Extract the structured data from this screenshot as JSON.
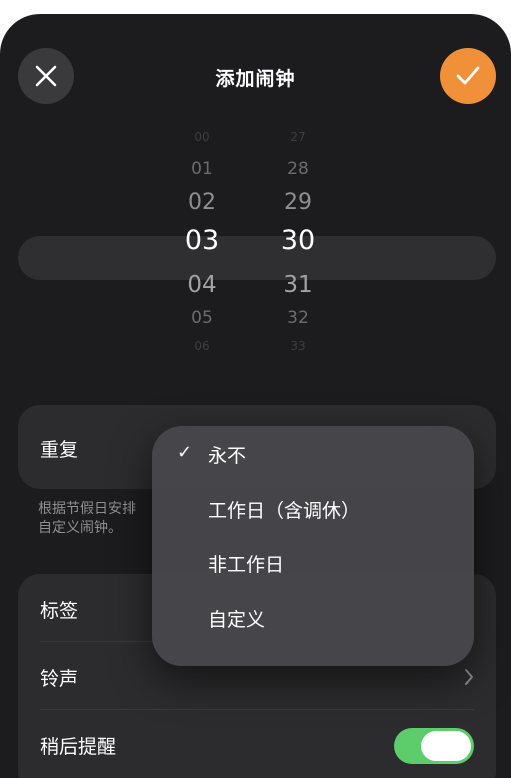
{
  "header": {
    "title": "添加闹钟",
    "close_icon": "close-icon",
    "confirm_icon": "checkmark-icon",
    "accent_color": "#f0913a"
  },
  "picker": {
    "hours": [
      "00",
      "01",
      "02",
      "03",
      "04",
      "05",
      "06"
    ],
    "minutes": [
      "27",
      "28",
      "29",
      "30",
      "31",
      "32",
      "33"
    ],
    "selected_hour": "03",
    "selected_minute": "30"
  },
  "repeat": {
    "label": "重复",
    "hint": "根据节假日安排",
    "hint_line2": "自定义闹钟。"
  },
  "menu": {
    "items": [
      {
        "label": "永不",
        "checked": true
      },
      {
        "label": "工作日（含调休）",
        "checked": false
      },
      {
        "label": "非工作日",
        "checked": false
      },
      {
        "label": "自定义",
        "checked": false
      }
    ],
    "check_glyph": "✓"
  },
  "settings": {
    "label_row": "标签",
    "ringtone_row": "铃声",
    "snooze_row": "稍后提醒",
    "snooze_on": true,
    "toggle_color": "#5dcc6b",
    "chevron_icon": "chevron-right-icon"
  }
}
